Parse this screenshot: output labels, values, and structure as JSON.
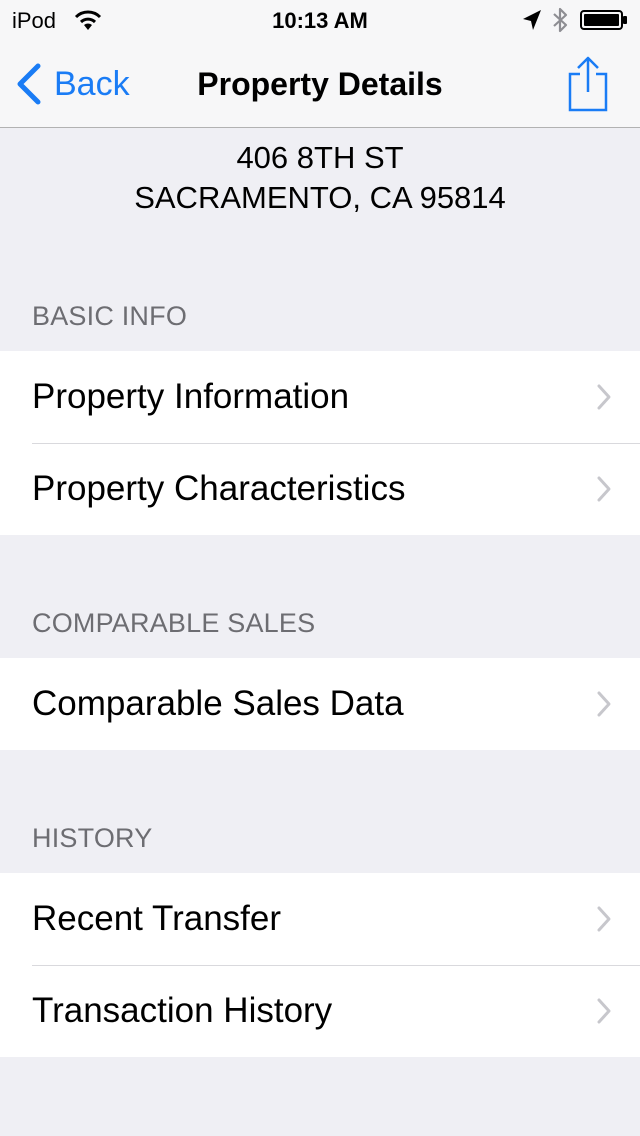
{
  "status_bar": {
    "carrier": "iPod",
    "time": "10:13 AM",
    "icons": [
      "wifi-icon",
      "location-arrow-icon",
      "bluetooth-icon",
      "battery-icon"
    ]
  },
  "nav": {
    "back_label": "Back",
    "title": "Property Details",
    "right_icon": "share-icon"
  },
  "address": {
    "line1": "406 8TH ST",
    "line2": "SACRAMENTO, CA 95814"
  },
  "sections": [
    {
      "header": "BASIC INFO",
      "items": [
        {
          "label": "Property Information"
        },
        {
          "label": "Property Characteristics"
        }
      ]
    },
    {
      "header": "COMPARABLE SALES",
      "items": [
        {
          "label": "Comparable Sales Data"
        }
      ]
    },
    {
      "header": "HISTORY",
      "items": [
        {
          "label": "Recent Transfer"
        },
        {
          "label": "Transaction History"
        }
      ]
    }
  ],
  "colors": {
    "accent": "#1a7cf5",
    "background": "#efeff4",
    "section_header": "#6d6d72",
    "disclosure": "#c7c7cc"
  }
}
